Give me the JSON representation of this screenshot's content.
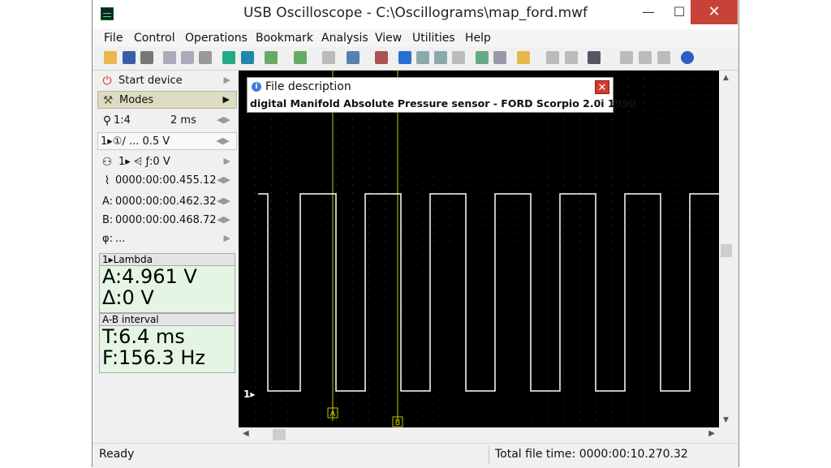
{
  "window": {
    "title": "USB Oscilloscope - C:\\Oscillograms\\map_ford.mwf",
    "min_glyph": "—",
    "max_glyph": "☐",
    "close_glyph": "✕"
  },
  "menu": [
    "File",
    "Control",
    "Operations",
    "Bookmark",
    "Analysis",
    "View",
    "Utilities",
    "Help"
  ],
  "left_panel": {
    "start_device": "Start device",
    "modes": "Modes",
    "zoom": "1:4",
    "timebase": "2 ms",
    "channel_line": "1▸①∕ ... 0.5 V",
    "trigger_line": "1▸ ⩤ ƒ:0 V",
    "trigger_time": "0000:00:00.455.12",
    "cursor_a": "0000:00:00.462.32",
    "cursor_b": "0000:00:00.468.72",
    "phi": "...",
    "label_a": "A:",
    "label_b": "B:",
    "label_phi": "φ:"
  },
  "lambda_panel": {
    "header": "1▸Lambda",
    "line1": "A:4.961 V",
    "line2": "Δ:0 V"
  },
  "interval_panel": {
    "header": "A-B interval",
    "line1": "T:6.4 ms",
    "line2": "F:156.3 Hz"
  },
  "file_description": {
    "title": "File description",
    "text": "digital Manifold Absolute Pressure sensor - FORD Scorpio 2.0i 1990"
  },
  "scope": {
    "channel_marker": "1▸",
    "cursor_a_label": "A",
    "cursor_b_label": "B",
    "trace_color": "#ffffff",
    "cursor_color": "#c8c800"
  },
  "status": {
    "left": "Ready",
    "right": "Total file time: 0000:00:10.270.32"
  }
}
